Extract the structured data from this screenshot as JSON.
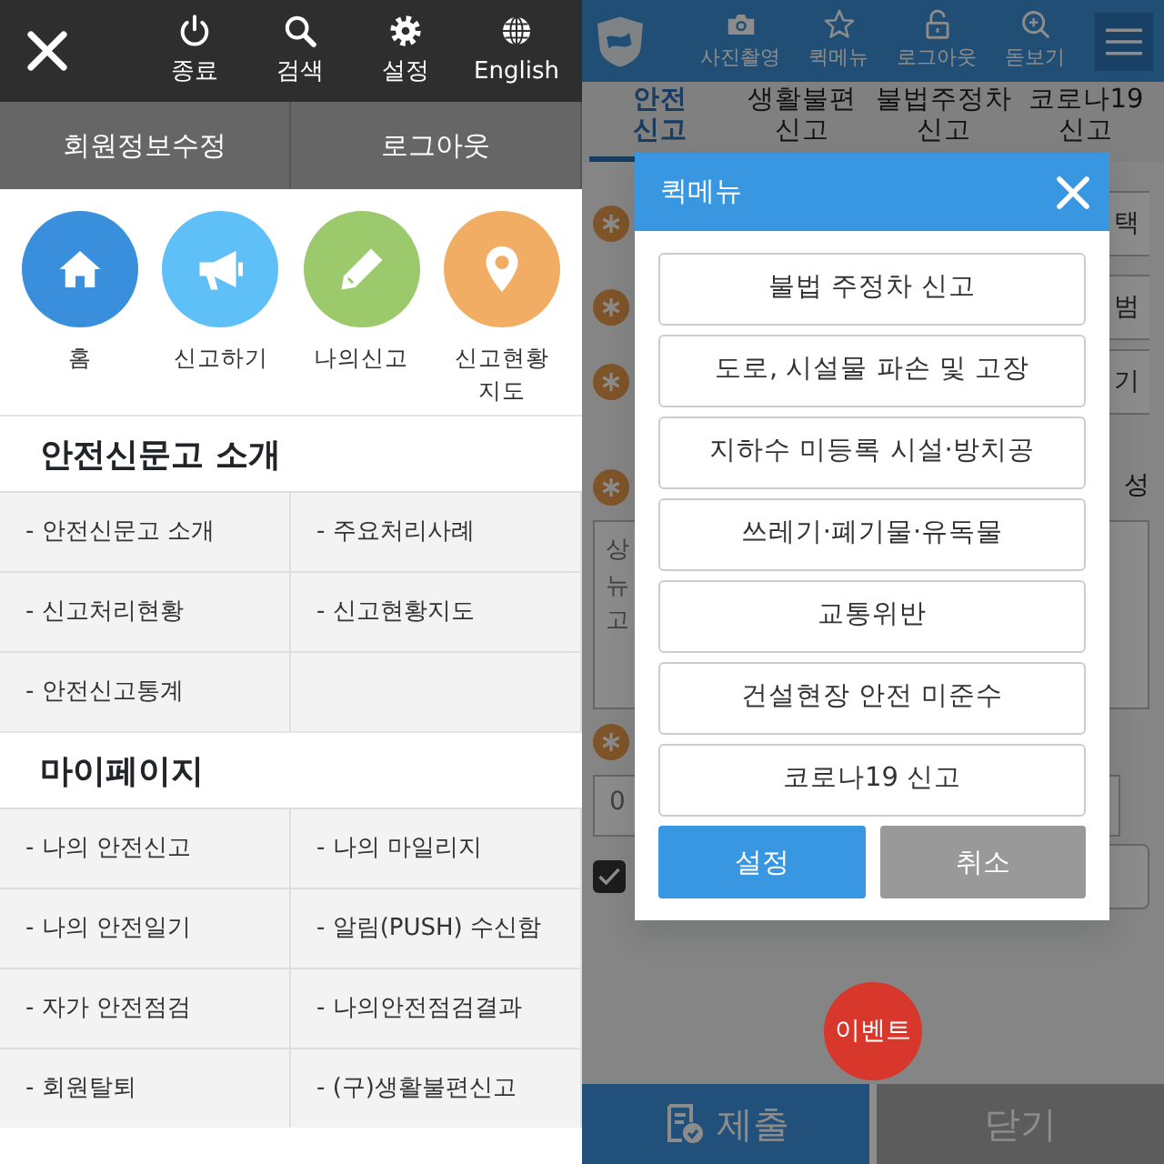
{
  "left_screen": {
    "toolbar": [
      {
        "label": "종료",
        "kind": "power"
      },
      {
        "label": "검색",
        "kind": "search"
      },
      {
        "label": "설정",
        "kind": "gear"
      },
      {
        "label": "English",
        "kind": "globe"
      }
    ],
    "account_buttons": [
      "회원정보수정",
      "로그아웃"
    ],
    "shortcuts": [
      {
        "label": "홈",
        "kind": "home",
        "color": "#3a8fdc"
      },
      {
        "label": "신고하기",
        "kind": "megaphone",
        "color": "#5ec0f6"
      },
      {
        "label": "나의신고",
        "kind": "pencil",
        "color": "#9cc96b"
      },
      {
        "label": "신고현황 지도",
        "kind": "pin",
        "color": "#f1ad64"
      }
    ],
    "sections": [
      {
        "title": "안전신문고 소개",
        "links": [
          "- 안전신문고 소개",
          "- 주요처리사례",
          "- 신고처리현황",
          "- 신고현황지도",
          "- 안전신고통계"
        ]
      },
      {
        "title": "마이페이지",
        "links": [
          "- 나의 안전신고",
          "- 나의 마일리지",
          "- 나의 안전일기",
          "- 알림(PUSH) 수신함",
          "- 자가 안전점검",
          "- 나의안전점검결과",
          "- 회원탈퇴",
          "- (구)생활불편신고"
        ]
      }
    ]
  },
  "right_screen": {
    "toolbar": [
      {
        "label": "사진촬영",
        "kind": "camera"
      },
      {
        "label": "퀵메뉴",
        "kind": "star"
      },
      {
        "label": "로그아웃",
        "kind": "lock"
      },
      {
        "label": "돋보기",
        "kind": "zoom"
      }
    ],
    "tabs": [
      {
        "label": "안전 신고",
        "selected": true
      },
      {
        "label": "생활불편 신고",
        "selected": false
      },
      {
        "label": "불법주정차 신고",
        "selected": false
      },
      {
        "label": "코로나19 신고",
        "selected": false
      }
    ],
    "background_form": {
      "side_buttons": [
        "택",
        "범",
        "기"
      ],
      "field_label": "성",
      "textarea_lines": [
        "상",
        "뉴",
        "고"
      ],
      "input_value": "0",
      "agree_checked": true
    },
    "quick_menu": {
      "title": "퀵메뉴",
      "items": [
        "불법 주정차 신고",
        "도로, 시설물 파손 및 고장",
        "지하수 미등록 시설·방치공",
        "쓰레기·폐기물·유독물",
        "교통위반",
        "건설현장 안전 미준수",
        "코로나19 신고"
      ],
      "buttons": [
        {
          "label": "설정",
          "kind": "primary"
        },
        {
          "label": "취소",
          "kind": "secondary"
        }
      ]
    },
    "event_button": "이벤트",
    "bottom_buttons": [
      {
        "label": "제출",
        "kind": "submit"
      },
      {
        "label": "닫기",
        "kind": "close"
      }
    ]
  }
}
